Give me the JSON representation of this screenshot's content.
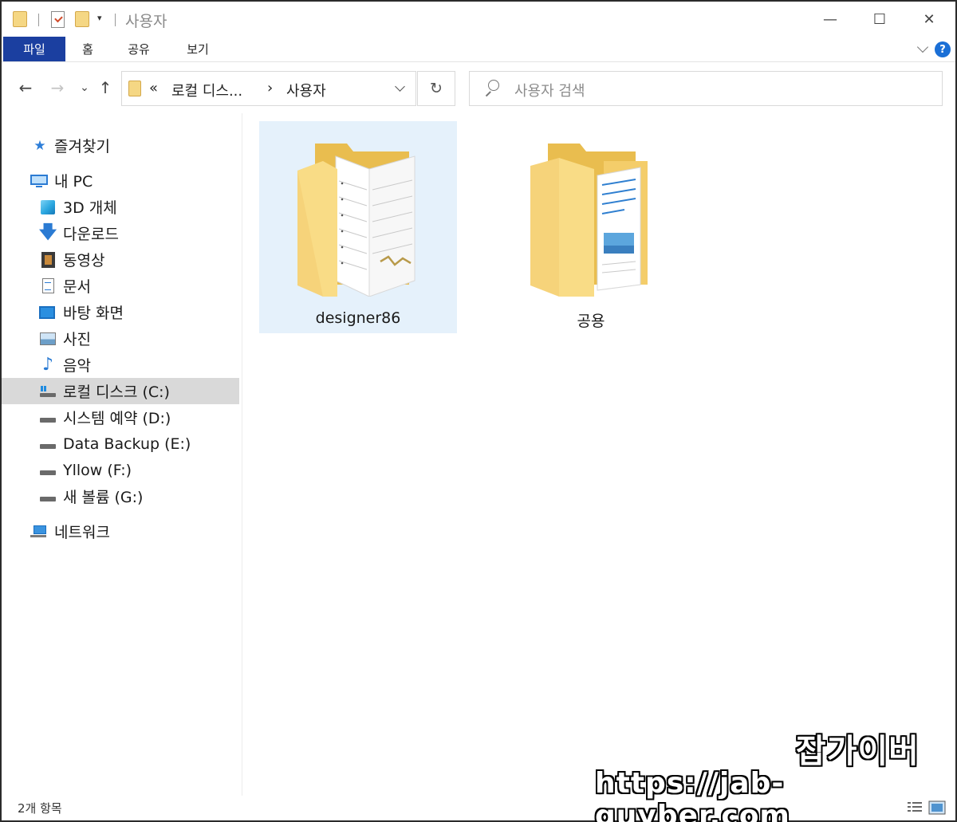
{
  "window": {
    "title": "사용자",
    "controls": {
      "minimize": "—",
      "maximize": "☐",
      "close": "✕"
    }
  },
  "ribbon": {
    "tabs": [
      {
        "label": "파일",
        "active": true
      },
      {
        "label": "홈"
      },
      {
        "label": "공유"
      },
      {
        "label": "보기"
      }
    ],
    "help": "?"
  },
  "navigation": {
    "back": "←",
    "forward": "→",
    "recent": "⌄",
    "up": "↑",
    "address": {
      "overflow": "«",
      "crumb1": "로컬 디스...",
      "separator": "›",
      "crumb2": "사용자"
    },
    "refresh": "↻",
    "search": {
      "placeholder": "사용자 검색"
    }
  },
  "sidebar": {
    "quick_access": {
      "label": "즐겨찾기",
      "icon": "star-icon"
    },
    "this_pc": {
      "label": "내 PC",
      "icon": "computer-icon"
    },
    "items": [
      {
        "label": "3D 개체",
        "icon": "3d-objects-icon"
      },
      {
        "label": "다운로드",
        "icon": "download-icon"
      },
      {
        "label": "동영상",
        "icon": "video-icon"
      },
      {
        "label": "문서",
        "icon": "document-icon"
      },
      {
        "label": "바탕 화면",
        "icon": "desktop-icon"
      },
      {
        "label": "사진",
        "icon": "pictures-icon"
      },
      {
        "label": "음악",
        "icon": "music-icon"
      },
      {
        "label": "로컬 디스크 (C:)",
        "icon": "system-drive-icon",
        "selected": true
      },
      {
        "label": "시스템 예약 (D:)",
        "icon": "drive-icon"
      },
      {
        "label": "Data Backup (E:)",
        "icon": "drive-icon"
      },
      {
        "label": "Yllow (F:)",
        "icon": "drive-icon"
      },
      {
        "label": "새 볼륨 (G:)",
        "icon": "drive-icon"
      }
    ],
    "network": {
      "label": "네트워크",
      "icon": "network-icon"
    }
  },
  "content": {
    "folders": [
      {
        "name": "designer86",
        "selected": true,
        "icon": "user-folder-icon"
      },
      {
        "name": "공용",
        "selected": false,
        "icon": "public-folder-icon"
      }
    ]
  },
  "status": {
    "item_count": "2개 항목"
  },
  "watermark": {
    "title": "잡가이버",
    "url": "https://jab-guyber.com"
  },
  "colors": {
    "accent": "#1b3fa0",
    "selection": "#e5f1fb",
    "sidebar_selected": "#d9d9d9",
    "folder": "#f5d784"
  }
}
